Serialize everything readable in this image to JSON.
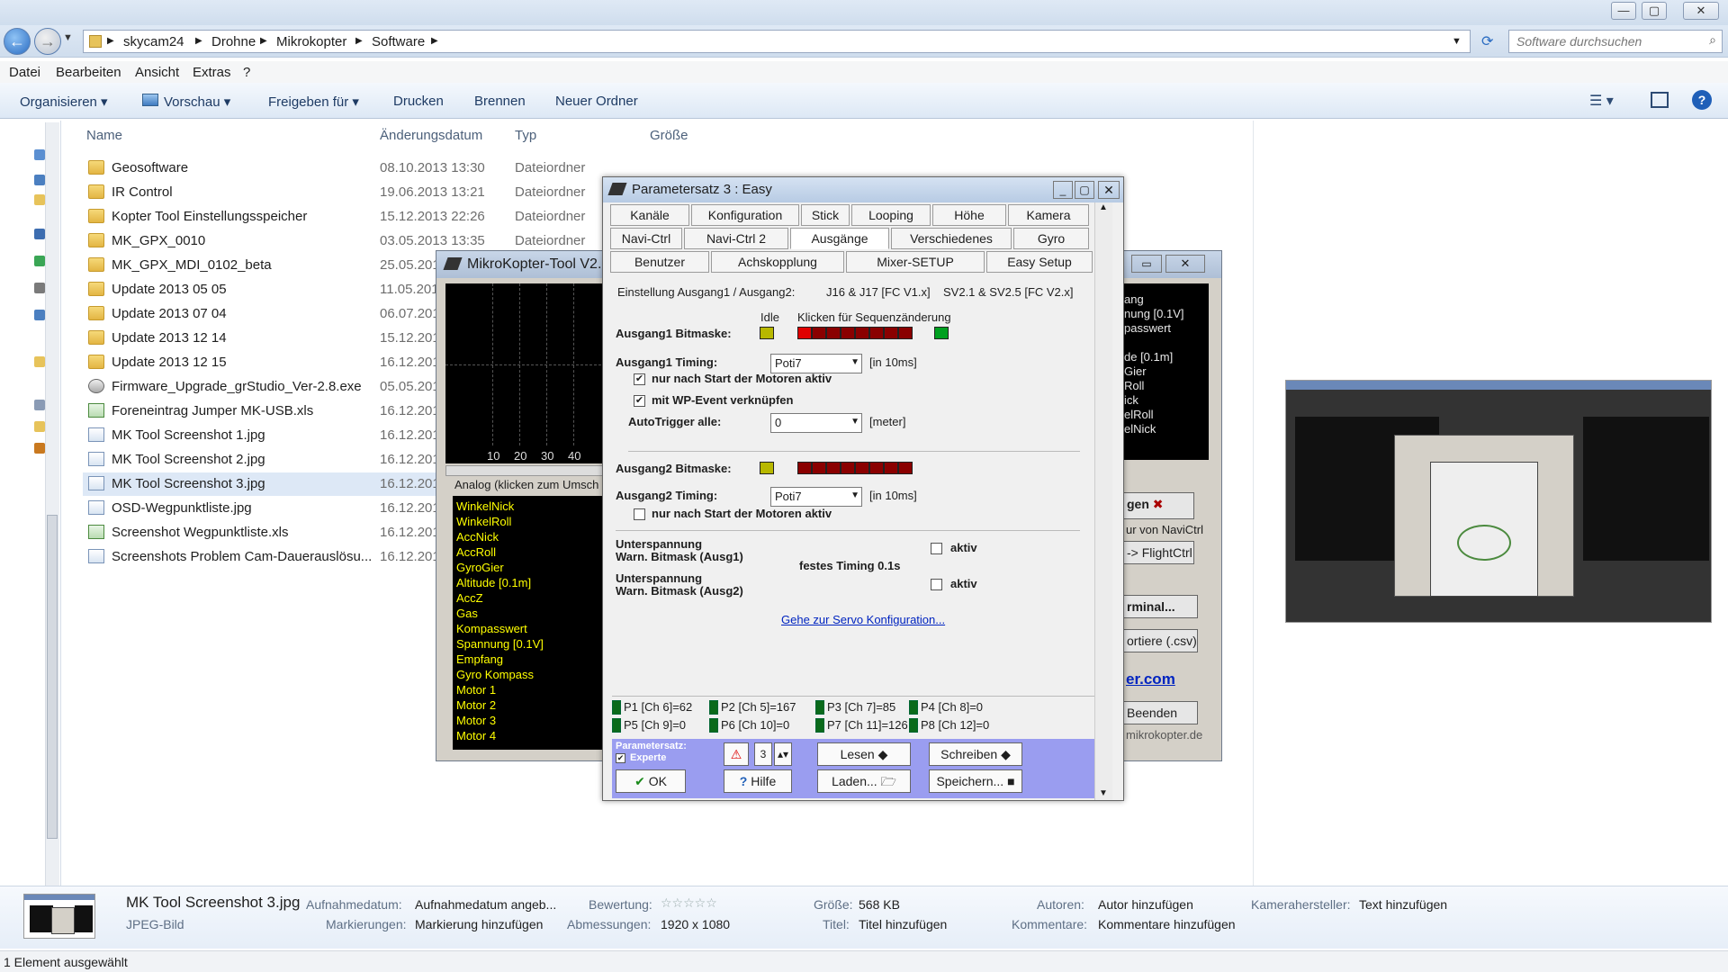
{
  "address": {
    "crumbs": [
      "skycam24",
      "Drohne",
      "Mikrokopter",
      "Software"
    ],
    "search_placeholder": "Software durchsuchen"
  },
  "menu": [
    "Datei",
    "Bearbeiten",
    "Ansicht",
    "Extras",
    "?"
  ],
  "toolbar": {
    "organize": "Organisieren ▾",
    "preview": "Vorschau ▾",
    "share": "Freigeben für ▾",
    "print": "Drucken",
    "burn": "Brennen",
    "new_folder": "Neuer Ordner"
  },
  "columns": {
    "name": "Name",
    "date": "Änderungsdatum",
    "type": "Typ",
    "size": "Größe"
  },
  "files": [
    {
      "name": "Geosoftware",
      "date": "08.10.2013 13:30",
      "type": "Dateiordner",
      "kind": "folder"
    },
    {
      "name": "IR Control",
      "date": "19.06.2013 13:21",
      "type": "Dateiordner",
      "kind": "folder"
    },
    {
      "name": "Kopter Tool Einstellungsspeicher",
      "date": "15.12.2013 22:26",
      "type": "Dateiordner",
      "kind": "folder"
    },
    {
      "name": "MK_GPX_0010",
      "date": "03.05.2013 13:35",
      "type": "Dateiordner",
      "kind": "folder"
    },
    {
      "name": "MK_GPX_MDI_0102_beta",
      "date": "25.05.201",
      "type": "",
      "kind": "folder"
    },
    {
      "name": "Update 2013 05 05",
      "date": "11.05.201",
      "type": "",
      "kind": "folder"
    },
    {
      "name": "Update 2013 07 04",
      "date": "06.07.201",
      "type": "",
      "kind": "folder"
    },
    {
      "name": "Update 2013 12 14",
      "date": "15.12.201",
      "type": "",
      "kind": "folder"
    },
    {
      "name": "Update 2013 12 15",
      "date": "16.12.201",
      "type": "",
      "kind": "folder"
    },
    {
      "name": "Firmware_Upgrade_grStudio_Ver-2.8.exe",
      "date": "05.05.201",
      "type": "",
      "kind": "exe"
    },
    {
      "name": "Foreneintrag Jumper MK-USB.xls",
      "date": "16.12.201",
      "type": "",
      "kind": "xls"
    },
    {
      "name": "MK Tool Screenshot 1.jpg",
      "date": "16.12.201",
      "type": "",
      "kind": "img"
    },
    {
      "name": "MK Tool Screenshot 2.jpg",
      "date": "16.12.201",
      "type": "",
      "kind": "img"
    },
    {
      "name": "MK Tool Screenshot 3.jpg",
      "date": "16.12.201",
      "type": "",
      "kind": "img",
      "selected": true
    },
    {
      "name": "OSD-Wegpunktliste.jpg",
      "date": "16.12.201",
      "type": "",
      "kind": "img"
    },
    {
      "name": "Screenshot Wegpunktliste.xls",
      "date": "16.12.201",
      "type": "",
      "kind": "xls"
    },
    {
      "name": "Screenshots Problem Cam-Dauerauslösu...",
      "date": "16.12.201",
      "type": "",
      "kind": "img"
    }
  ],
  "details": {
    "filename": "MK Tool Screenshot 3.jpg",
    "filetype": "JPEG-Bild",
    "rec_date_label": "Aufnahmedatum:",
    "rec_date_val": "Aufnahmedatum angeb...",
    "tags_label": "Markierungen:",
    "tags_val": "Markierung hinzufügen",
    "rating_label": "Bewertung:",
    "rating_stars": "☆☆☆☆☆",
    "dims_label": "Abmessungen:",
    "dims_val": "1920 x 1080",
    "size_label": "Größe:",
    "size_val": "568 KB",
    "title_label": "Titel:",
    "title_val": "Titel hinzufügen",
    "authors_label": "Autoren:",
    "authors_val": "Autor hinzufügen",
    "comments_label": "Kommentare:",
    "comments_val": "Kommentare hinzufügen",
    "camera_label": "Kamerahersteller:",
    "camera_val": "Text hinzufügen"
  },
  "status": "1 Element ausgewählt",
  "mk": {
    "title": "MikroKopter-Tool V2.0",
    "scope_ticks": [
      "10",
      "20",
      "30",
      "40"
    ],
    "analog_label": "Analog (klicken zum Umsch",
    "signals": [
      "WinkelNick",
      "WinkelRoll",
      "AccNick",
      "AccRoll",
      "GyroGier",
      "Altitude [0.1m]",
      "AccZ",
      "Gas",
      "Kompasswert",
      "Spannung [0.1V]",
      "Empfang",
      "Gyro Kompass",
      "Motor 1",
      "Motor 2",
      "Motor 3",
      "Motor 4"
    ],
    "right_signals": [
      "ang",
      "nung [0.1V]",
      "passwert",
      "",
      "de [0.1m]",
      "Gier",
      "Roll",
      "ick",
      "elRoll",
      "elNick"
    ],
    "btn_gen": "gen",
    "navictrl_text": "ur von NaviCtrl",
    "flightctrl_btn": "-> FlightCtrl",
    "terminal_btn": "rminal...",
    "export_btn": "ortiere (.csv)",
    "site_link": "er.com",
    "quit_btn": "Beenden",
    "site_text": "mikrokopter.de"
  },
  "param": {
    "title": "Parametersatz 3 : Easy",
    "tabs_row1": [
      "Kanäle",
      "Konfiguration",
      "Stick",
      "Looping",
      "Höhe",
      "Kamera"
    ],
    "tabs_row2": [
      "Navi-Ctrl",
      "Navi-Ctrl 2",
      "Ausgänge",
      "Verschiedenes",
      "Gyro"
    ],
    "tabs_row3": [
      "Benutzer",
      "Achskopplung",
      "Mixer-SETUP",
      "Easy Setup"
    ],
    "header_line": "Einstellung Ausgang1 / Ausgang2:",
    "header_j": "J16 & J17 [FC V1.x]",
    "header_sv": "SV2.1 & SV2.5 [FC V2.x]",
    "idle_label": "Idle",
    "seq_label": "Klicken für Sequenzänderung",
    "out1_mask_label": "Ausgang1 Bitmaske:",
    "out1_timing_label": "Ausgang1 Timing:",
    "out1_timing_val": "Poti7",
    "unit_10ms": "[in 10ms]",
    "motors_only_label": "nur nach Start der Motoren aktiv",
    "wp_event_label": "mit WP-Event verknüpfen",
    "autotrigger_label": "AutoTrigger alle:",
    "autotrigger_val": "0",
    "meter_unit": "[meter]",
    "out2_mask_label": "Ausgang2 Bitmaske:",
    "out2_timing_label": "Ausgang2 Timing:",
    "out2_timing_val": "Poti7",
    "undervolt1_a": "Unterspannung",
    "undervolt1_b": "Warn. Bitmask (Ausg1)",
    "undervolt2_a": "Unterspannung",
    "undervolt2_b": "Warn. Bitmask (Ausg2)",
    "fixed_timing": "festes Timing 0.1s",
    "active_label": "aktiv",
    "servo_link": "Gehe zur Servo Konfiguration...",
    "channels": [
      "P1 [Ch 6]=62",
      "P2 [Ch 5]=167",
      "P3 [Ch 7]=85",
      "P4 [Ch 8]=0",
      "P5 [Ch 9]=0",
      "P6 [Ch 10]=0",
      "P7 [Ch 11]=126",
      "P8 [Ch 12]=0"
    ],
    "paramset_label": "Parametersatz:",
    "expert_label": "Experte",
    "set_number": "3",
    "read_btn": "Lesen",
    "write_btn": "Schreiben",
    "ok_btn": "OK",
    "help_btn": "Hilfe",
    "load_btn": "Laden...",
    "save_btn": "Speichern..."
  },
  "colors": {
    "accent": "#2a6cc2",
    "led_red": "#8a0000",
    "led_red_on": "#e00000",
    "led_yellow": "#b8b800",
    "led_green": "#00a020",
    "footer": "#9a9df0"
  }
}
